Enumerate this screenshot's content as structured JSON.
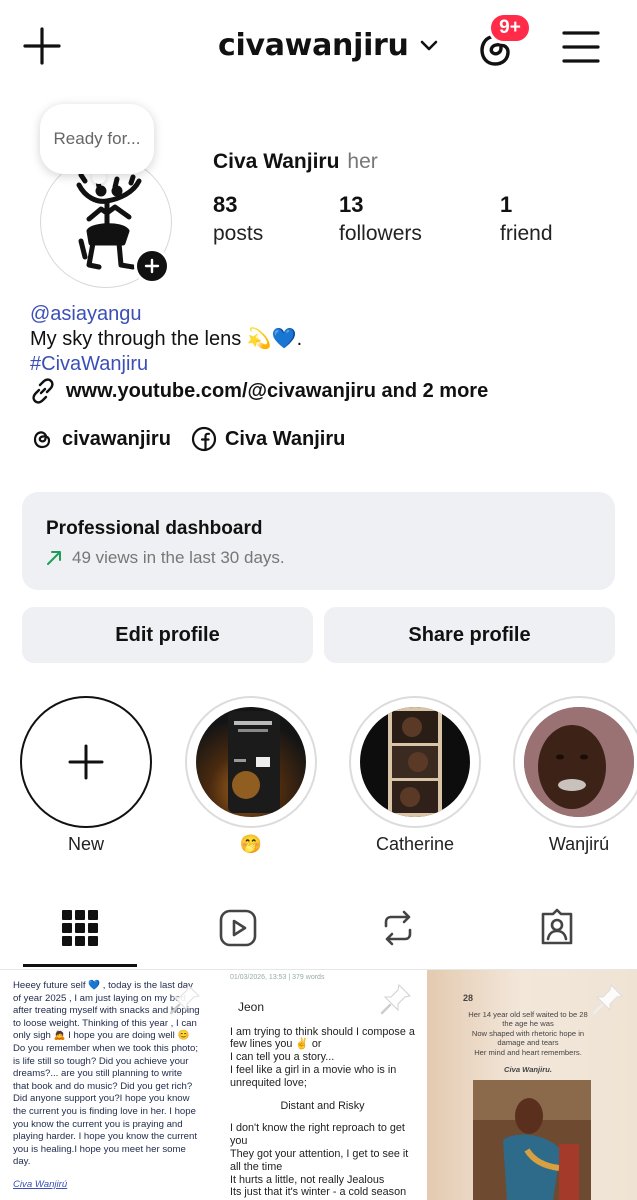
{
  "header": {
    "username": "civawanjiru",
    "notification_badge": "9+"
  },
  "profile": {
    "note": "Ready for...",
    "full_name": "Civa Wanjiru",
    "pronouns": "her",
    "stats": [
      {
        "value": "83",
        "label": "posts"
      },
      {
        "value": "13",
        "label": "followers"
      },
      {
        "value": "1",
        "label": "friend"
      }
    ],
    "bio": {
      "mention": "@asiayangu",
      "line": "My sky through the lens 💫💙.",
      "hashtag": "#CivaWanjiru"
    },
    "link": "www.youtube.com/@civawanjiru and 2 more",
    "social": [
      {
        "icon": "threads-icon",
        "label": "civawanjiru"
      },
      {
        "icon": "facebook-icon",
        "label": "Civa Wanjiru"
      }
    ]
  },
  "dashboard": {
    "title": "Professional dashboard",
    "subtitle": "49 views in the last 30 days."
  },
  "buttons": {
    "edit": "Edit profile",
    "share": "Share profile"
  },
  "highlights": [
    {
      "label": "New"
    },
    {
      "label": "🤭"
    },
    {
      "label": "Catherine"
    },
    {
      "label": "Wanjirú"
    }
  ],
  "tabs": [
    "grid-icon",
    "reels-icon",
    "reposts-icon",
    "tagged-icon"
  ],
  "posts": {
    "p1": {
      "text": "Heeey future self 💙 , today is the last day of year 2025 , I am just laying on my bed after treating myself with snacks and hoping to loose weight. Thinking of this year , I can only sigh 🙇 I hope you are doing well 😊 Do you remember when we took this photo; is life still so tough? Did you achieve your dreams?... are you still planning to write that book and do music? Did you get rich?Did anyone support you?I hope you know the current you is finding love in her. I hope you know the current you is praying and playing harder. I hope you know the current you is healing.I hope you meet her some day.",
      "signature": "Civa Wanjirú"
    },
    "p2": {
      "meta": "01/03/2026, 13:53  |  379 words",
      "title": "Jeon",
      "para1": "I am trying to think should I compose a few lines you ✌ or\nI can tell you a story...\nI feel like a girl in a movie who is in unrequited love;",
      "center": "Distant and Risky",
      "para2": "I don't know the right reproach to get you\nThey got your attention, I get to see it all the time\nIt hurts a little, not really Jealous\nIts just that it's winter - a cold season\nIn my heart and pocket."
    },
    "p3": {
      "number": "28",
      "text": "Her 14 year old self waited to be 28\nthe age he was\nNow shaped with rhetoric hope in damage and tears\nHer mind and heart remembers.",
      "signature": "Civa Wanjiru."
    }
  }
}
